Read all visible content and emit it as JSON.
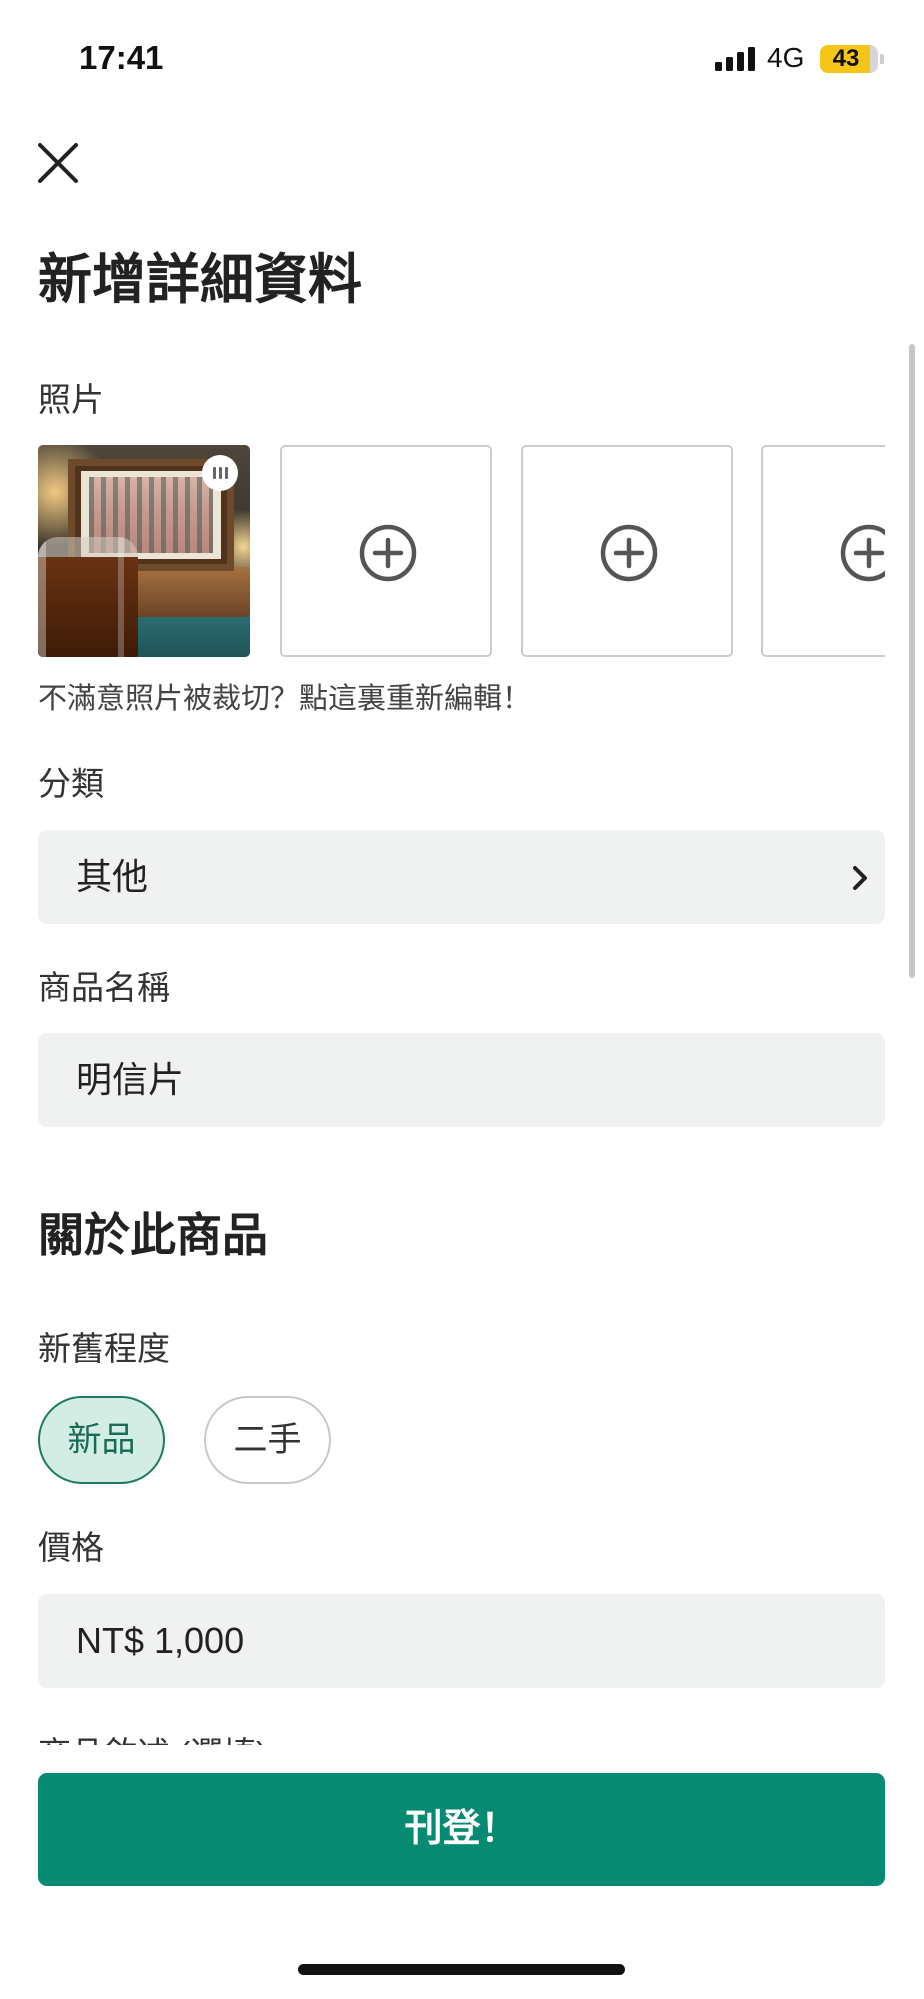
{
  "status_bar": {
    "time": "17:41",
    "network": "4G",
    "battery": "43",
    "signal_icon": "signal-icon",
    "battery_icon": "battery-icon"
  },
  "header": {
    "close_icon": "close-icon",
    "title": "新增詳細資料"
  },
  "photos": {
    "label": "照片",
    "add_icon": "plus-circle-icon",
    "handle_icon": "drag-handle-icon",
    "edit_hint": "不滿意照片被裁切？點這裏重新編輯！"
  },
  "category": {
    "label": "分類",
    "value": "其他",
    "icon": "chevron-right-icon"
  },
  "product_name": {
    "label": "商品名稱",
    "value": "明信片"
  },
  "about": {
    "heading": "關於此商品"
  },
  "condition": {
    "label": "新舊程度",
    "options": [
      {
        "label": "新品",
        "selected": true
      },
      {
        "label": "二手",
        "selected": false
      }
    ]
  },
  "price": {
    "label": "價格",
    "value": "NT$ 1,000"
  },
  "description": {
    "label": "商品敘述 (選填)"
  },
  "submit": {
    "label": "刊登！"
  },
  "colors": {
    "accent": "#078a72",
    "chip_selected_bg": "#d3ede5",
    "chip_selected_border": "#1c7a62",
    "field_bg": "#f0f1f1",
    "battery_fill": "#f5c518"
  }
}
